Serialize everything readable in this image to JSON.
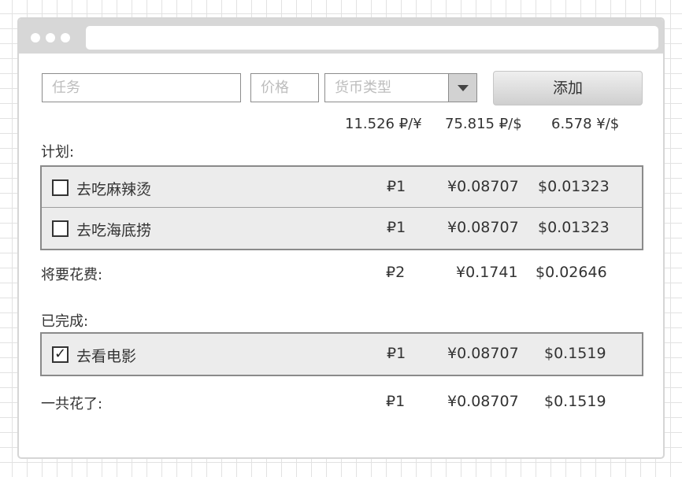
{
  "form": {
    "task_placeholder": "任务",
    "price_placeholder": "价格",
    "currency_placeholder": "货币类型",
    "add_label": "添加"
  },
  "rates": {
    "rub_cny": "11.526 ₽/¥",
    "rub_usd": "75.815 ₽/$",
    "cny_usd": "6.578 ¥/$"
  },
  "planned": {
    "heading": "计划:",
    "items": [
      {
        "name": "去吃麻辣烫",
        "rub": "₽1",
        "cny": "¥0.08707",
        "usd": "$0.01323",
        "checked": false
      },
      {
        "name": "去吃海底捞",
        "rub": "₽1",
        "cny": "¥0.08707",
        "usd": "$0.01323",
        "checked": false
      }
    ],
    "total_label": "将要花费:",
    "total_rub": "₽2",
    "total_cny": "¥0.1741",
    "total_usd": "$0.02646"
  },
  "completed": {
    "heading": "已完成:",
    "items": [
      {
        "name": "去看电影",
        "rub": "₽1",
        "cny": "¥0.08707",
        "usd": "$0.1519",
        "checked": true
      }
    ],
    "total_label": "一共花了:",
    "total_rub": "₽1",
    "total_cny": "¥0.08707",
    "total_usd": "$0.1519"
  },
  "check_glyph": "✓"
}
